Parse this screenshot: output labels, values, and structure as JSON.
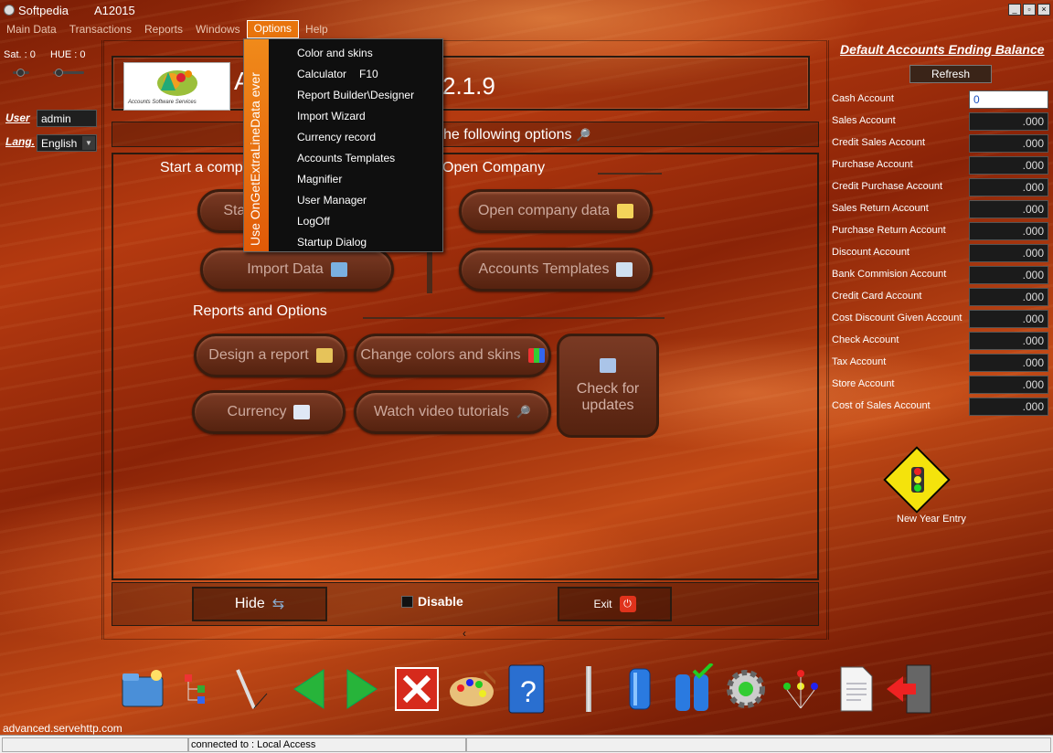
{
  "window": {
    "title": "Softpedia",
    "subtitle": "A12015"
  },
  "menu": [
    "Main Data",
    "Transactions",
    "Reports",
    "Windows",
    "Options",
    "Help"
  ],
  "left": {
    "sat_label": "Sat. :",
    "sat_value": "0",
    "hue_label": "HUE :",
    "hue_value": "0",
    "user_label": "User",
    "user_value": "admin",
    "lang_label": "Lang.",
    "lang_value": "English"
  },
  "header": {
    "app_title": "A",
    "watermark": "SOFTPEDIA",
    "version": "2.1.9",
    "logo_caption": "Accounts Software Services"
  },
  "options_bar": {
    "text": "he following options"
  },
  "sections": {
    "start": "Start a compa",
    "open": "Open Company",
    "reports": "Reports and Options"
  },
  "buttons": {
    "start_partial": "Star",
    "open_company": "Open company data",
    "import_data": "Import Data",
    "accounts_templates": "Accounts Templates",
    "design_report": "Design a report",
    "change_colors": "Change colors and skins",
    "check_updates_1": "Check for",
    "check_updates_2": "updates",
    "currency": "Currency",
    "watch_video": "Watch video tutorials",
    "hide": "Hide",
    "disable": "Disable",
    "exit": "Exit"
  },
  "dropdown": {
    "strip_text": "Use OnGetExtraLineData ever",
    "items": [
      {
        "label": "Color and skins",
        "shortcut": ""
      },
      {
        "label": "Calculator",
        "shortcut": "F10"
      },
      {
        "label": "Report Builder\\Designer",
        "shortcut": ""
      },
      {
        "label": "Import Wizard",
        "shortcut": ""
      },
      {
        "label": "Currency record",
        "shortcut": ""
      },
      {
        "label": "Accounts Templates",
        "shortcut": ""
      },
      {
        "label": "Magnifier",
        "shortcut": ""
      },
      {
        "label": "User Manager",
        "shortcut": ""
      },
      {
        "label": "LogOff",
        "shortcut": ""
      },
      {
        "label": "Startup Dialog",
        "shortcut": ""
      }
    ]
  },
  "right": {
    "title": "Default Accounts Ending Balance",
    "refresh": "Refresh",
    "accounts": [
      {
        "label": "Cash Account",
        "value": "0"
      },
      {
        "label": "Sales Account",
        "value": ".000"
      },
      {
        "label": "Credit Sales Account",
        "value": ".000"
      },
      {
        "label": "Purchase Account",
        "value": ".000"
      },
      {
        "label": "Credit Purchase Account",
        "value": ".000"
      },
      {
        "label": "Sales Return Account",
        "value": ".000"
      },
      {
        "label": "Purchase Return Account",
        "value": ".000"
      },
      {
        "label": "Discount Account",
        "value": ".000"
      },
      {
        "label": "Bank Commision Account",
        "value": ".000"
      },
      {
        "label": "Credit Card Account",
        "value": ".000"
      },
      {
        "label": "Cost Discount Given Account",
        "value": ".000"
      },
      {
        "label": "Check Account",
        "value": ".000"
      },
      {
        "label": "Tax Account",
        "value": ".000"
      },
      {
        "label": "Store Account",
        "value": ".000"
      },
      {
        "label": "Cost of Sales Account",
        "value": ".000"
      }
    ],
    "new_year": "New Year Entry"
  },
  "toolbar_icons": [
    "folder-open-icon",
    "tree-icon",
    "pen-icon",
    "back-arrow-icon",
    "forward-arrow-icon",
    "close-x-icon",
    "palette-icon",
    "help-book-icon",
    "separator-icon",
    "database-icon",
    "database-check-icon",
    "gear-icon",
    "network-icon",
    "document-icon",
    "exit-door-icon"
  ],
  "footer": {
    "url": "advanced.servehttp.com",
    "status": "connected to : Local Access"
  },
  "colors": {
    "menu_active": "#e8740c",
    "strip": "#f08a1a",
    "panel_bg": "#8a2307"
  }
}
